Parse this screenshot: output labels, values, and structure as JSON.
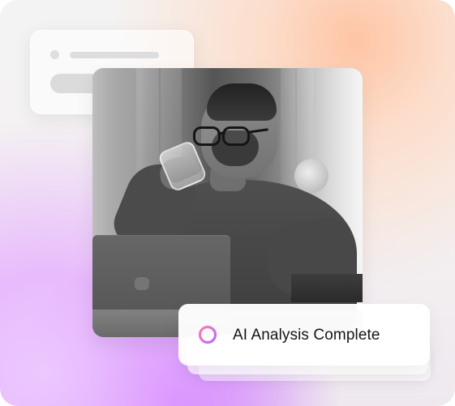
{
  "status_card": {
    "text": "AI Analysis Complete",
    "icon": "ring-icon",
    "icon_colors": [
      "#ff6ca8",
      "#b56cff"
    ]
  },
  "colors": {
    "status_text": "#151515",
    "card_background": "#ffffff"
  }
}
